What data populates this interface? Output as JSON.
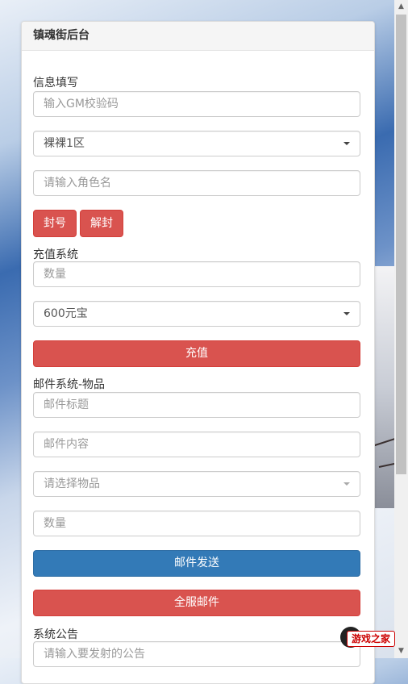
{
  "panel": {
    "title": "镇魂街后台"
  },
  "info_section": {
    "label": "信息填写",
    "gm_code_placeholder": "输入GM校验码",
    "server_selected": "裸裸1区",
    "role_name_placeholder": "请输入角色名",
    "ban_button": "封号",
    "unban_button": "解封"
  },
  "recharge_section": {
    "label": "充值系统",
    "amount_placeholder": "数量",
    "package_selected": "600元宝",
    "recharge_button": "充值"
  },
  "mail_section": {
    "label": "邮件系统-物品",
    "title_placeholder": "邮件标题",
    "content_placeholder": "邮件内容",
    "item_select_placeholder": "请选择物品",
    "quantity_placeholder": "数量",
    "send_button": "邮件发送",
    "all_server_button": "全服邮件"
  },
  "announce_section": {
    "label": "系统公告",
    "announce_placeholder": "请输入要发射的公告"
  },
  "watermark": {
    "text": "游戏之家"
  },
  "colors": {
    "danger": "#d9534f",
    "primary": "#337ab7"
  }
}
